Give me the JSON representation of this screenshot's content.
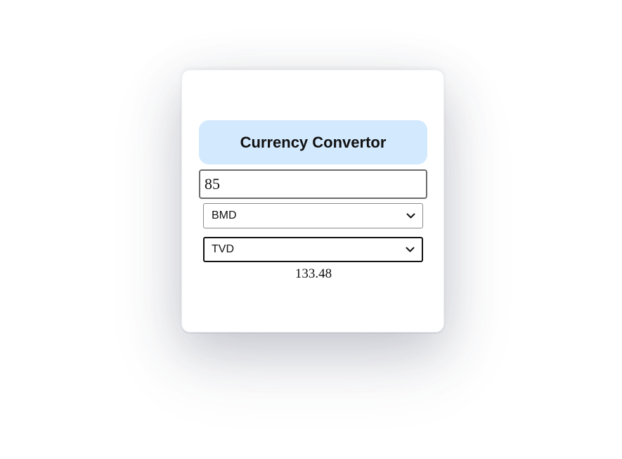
{
  "converter": {
    "title": "Currency Convertor",
    "amount_value": "85",
    "from_currency": "BMD",
    "to_currency": "TVD",
    "result": "133.48"
  },
  "icons": {
    "dropdown": "chevron-down-icon"
  },
  "colors": {
    "title_background": "#d3e9fd",
    "card_background": "#ffffff"
  }
}
